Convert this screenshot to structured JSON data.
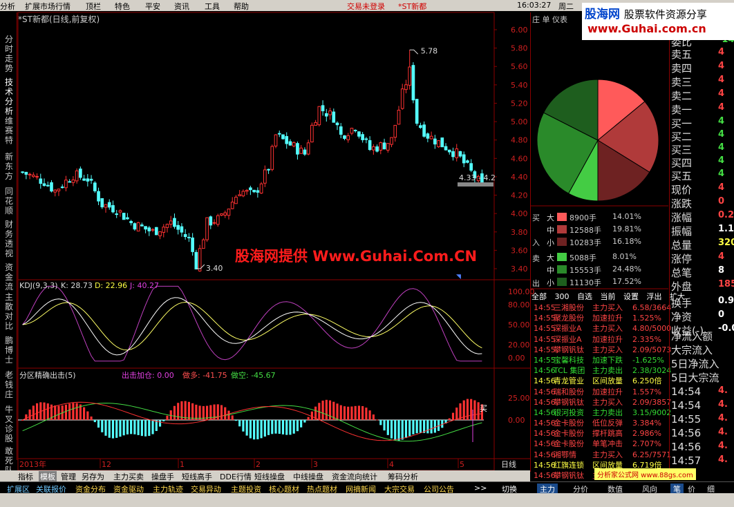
{
  "menu": {
    "items": [
      "分析",
      "扩展市场行情",
      "顶栏",
      "特色",
      "平安",
      "资讯",
      "工具",
      "帮助"
    ],
    "status_login": "交易未登录",
    "status_stock": "*ST新都",
    "clock": "16:03:27",
    "weekday": "周二"
  },
  "logo": {
    "site": "股海网",
    "tagline": "股票软件资源分享",
    "url": "www.Guhai.com.cn"
  },
  "left_tabs": [
    "分时走势",
    "技术分析",
    "维赛特",
    "新东方",
    "同花顺",
    "财务透视",
    "资金流",
    "主散对比",
    "鹏博士",
    "老钱庄",
    "牛叉诊股",
    "敢死队"
  ],
  "chart": {
    "title": "*ST新都(日线,前复权)",
    "y_ticks": [
      "6.00",
      "5.80",
      "5.60",
      "5.40",
      "5.20",
      "5.00",
      "4.80",
      "4.60",
      "4.40",
      "4.20",
      "4.00",
      "3.80",
      "3.60",
      "3.40"
    ],
    "max_label": "5.78",
    "min_label": "3.40",
    "range_label": "4.33 - 4.2",
    "watermark": "股海网提供 Www.Guhai.Com.CN",
    "x_labels": [
      "2013年",
      "12",
      "1",
      "2",
      "3",
      "4",
      "5"
    ],
    "period": "日线"
  },
  "kdj": {
    "name": "KDJ(9,3,3)",
    "k": "K: 28.73",
    "d": "D: 22.96",
    "j": "J: 40.27",
    "ticks": [
      "100.00",
      "80.00",
      "50.00",
      "20.00",
      "0.00"
    ]
  },
  "macd": {
    "name": "分区精确出击(5)",
    "buy": "出击加仓: 0.00",
    "long": "做多: -41.75",
    "short": "做空: -45.67",
    "ticks": [
      "25.00",
      "0.00"
    ],
    "buy_marker": "买"
  },
  "right_tabs": [
    "庄",
    "单",
    "仪表"
  ],
  "pie": {
    "slices": [
      {
        "pct": 14.01,
        "color": "#ff5a5a"
      },
      {
        "pct": 19.81,
        "color": "#b03a3a"
      },
      {
        "pct": 16.18,
        "color": "#6e2222"
      },
      {
        "pct": 8.01,
        "color": "#44cc44"
      },
      {
        "pct": 24.48,
        "color": "#2a8a2a"
      },
      {
        "pct": 17.52,
        "color": "#1e5e1e"
      }
    ]
  },
  "flow": {
    "buy_side": {
      "label_top": "买",
      "label_bottom": "入",
      "rows": [
        {
          "size": "大",
          "amount": "8900手",
          "pct": "14.01%",
          "color": "#ff5a5a"
        },
        {
          "size": "中",
          "amount": "12588手",
          "pct": "19.81%",
          "color": "#b03a3a"
        },
        {
          "size": "小",
          "amount": "10283手",
          "pct": "16.18%",
          "color": "#6e2222"
        }
      ]
    },
    "sell_side": {
      "label_top": "卖",
      "label_bottom": "出",
      "rows": [
        {
          "size": "大",
          "amount": "5088手",
          "pct": "8.01%",
          "color": "#44cc44"
        },
        {
          "size": "中",
          "amount": "15553手",
          "pct": "24.48%",
          "color": "#2a8a2a"
        },
        {
          "size": "小",
          "amount": "11130手",
          "pct": "17.52%",
          "color": "#1e5e1e"
        }
      ]
    }
  },
  "filter_tabs": [
    "全部",
    "300",
    "自选",
    "当前",
    "设置",
    "浮出",
    "扩大"
  ],
  "deals": [
    {
      "time": "14:55",
      "name": "三湘股份",
      "action": "主力买入",
      "value": "6.58/3664",
      "color": "#ff4444"
    },
    {
      "time": "14:55",
      "name": "聚龙股份",
      "action": "加速拉升",
      "value": "1.525%",
      "color": "#ff4444"
    },
    {
      "time": "14:55",
      "name": "深振业A",
      "action": "主力买入",
      "value": "4.80/5000",
      "color": "#ff4444"
    },
    {
      "time": "14:55",
      "name": "深振业A",
      "action": "加速拉升",
      "value": "2.335%",
      "color": "#ff4444"
    },
    {
      "time": "14:55",
      "name": "攀钢钒钛",
      "action": "主力买入",
      "value": "2.09/5073",
      "color": "#ff4444"
    },
    {
      "time": "14:55",
      "name": "宝馨科技",
      "action": "加速下跌",
      "value": "-1.625%",
      "color": "#33dd33"
    },
    {
      "time": "14:56",
      "name": "TCL 集团",
      "action": "主力卖出",
      "value": "2.38/3024",
      "color": "#33dd33"
    },
    {
      "time": "14:56",
      "name": "青龙管业",
      "action": "区间放量",
      "value": "6.250倍",
      "color": "#ffff44"
    },
    {
      "time": "14:56",
      "name": "瑞和股份",
      "action": "加速拉升",
      "value": "1.557%",
      "color": "#ff4444"
    },
    {
      "time": "14:56",
      "name": "攀钢钒钛",
      "action": "主力买入",
      "value": "2.09/3857",
      "color": "#ff4444"
    },
    {
      "time": "14:56",
      "name": "银河投资",
      "action": "主力卖出",
      "value": "3.15/9002",
      "color": "#33dd33"
    },
    {
      "time": "14:56",
      "name": "金卡股份",
      "action": "低位反弹",
      "value": "3.384%",
      "color": "#ff4444"
    },
    {
      "time": "14:56",
      "name": "金卡股份",
      "action": "撑杆跳高",
      "value": "2.986%",
      "color": "#ff4444"
    },
    {
      "time": "14:56",
      "name": "金卡股份",
      "action": "单笔冲击",
      "value": "2.707%",
      "color": "#ff4444"
    },
    {
      "time": "14:56",
      "name": "湘鄂情",
      "action": "主力买入",
      "value": "6.25/7571",
      "color": "#ff4444"
    },
    {
      "time": "14:56",
      "name": "红旗连锁",
      "action": "区间放量",
      "value": "6.719倍",
      "color": "#ffff44"
    },
    {
      "time": "14:56",
      "name": "攀钢钒钛",
      "action": "主力买入",
      "value": "",
      "color": "#ff4444"
    }
  ],
  "quote": {
    "weibi": "委比",
    "weibi_val": "-14.4",
    "sell_levels": [
      {
        "label": "卖五",
        "val": "4"
      },
      {
        "label": "卖四",
        "val": "4"
      },
      {
        "label": "卖三",
        "val": "4"
      },
      {
        "label": "卖二",
        "val": "4"
      },
      {
        "label": "卖一",
        "val": "4"
      }
    ],
    "buy_levels": [
      {
        "label": "买一",
        "val": "4"
      },
      {
        "label": "买二",
        "val": "4"
      },
      {
        "label": "买三",
        "val": "4"
      },
      {
        "label": "买四",
        "val": "4"
      },
      {
        "label": "买五",
        "val": "4"
      }
    ],
    "stats": [
      {
        "label": "现价",
        "val": "4",
        "color": "#ff4444"
      },
      {
        "label": "涨跌",
        "val": "0",
        "color": "#ff4444"
      },
      {
        "label": "涨幅",
        "val": "0.2",
        "color": "#ff4444"
      },
      {
        "label": "振幅",
        "val": "1.1",
        "color": "#ffffff"
      },
      {
        "label": "总量",
        "val": "320",
        "color": "#ffff44"
      },
      {
        "label": "涨停",
        "val": "4",
        "color": "#ff4444"
      },
      {
        "label": "总笔",
        "val": "8",
        "color": "#ffffff"
      },
      {
        "label": "外盘",
        "val": "185",
        "color": "#ff4444"
      },
      {
        "label": "换手",
        "val": "0.9",
        "color": "#ffffff"
      },
      {
        "label": "净资",
        "val": "0",
        "color": "#ffffff"
      },
      {
        "label": "收益(-)",
        "val": "-0.0",
        "color": "#ffffff"
      }
    ],
    "flows": [
      "净流入额",
      "大宗流入",
      "5日净流入",
      "5日大宗流"
    ],
    "ticks": [
      {
        "time": "14:54",
        "val": "4."
      },
      {
        "time": "14:54",
        "val": "4."
      },
      {
        "time": "14:55",
        "val": "4."
      },
      {
        "time": "14:56",
        "val": "4."
      },
      {
        "time": "14:56",
        "val": "4."
      },
      {
        "time": "14:57",
        "val": "4."
      }
    ]
  },
  "indicator_tabs": [
    "指标",
    "模板",
    "管理",
    "另存为",
    "主力买卖",
    "操盘手",
    "短线高手",
    "DDE行情",
    "短线操盘",
    "中线操盘",
    "资金流向统计",
    "筹码分析"
  ],
  "bottom_tabs": [
    "扩展区",
    "关联报价",
    "资金分布",
    "资金驱动",
    "主力轨迹",
    "交易异动",
    "主题投资",
    "核心题材",
    "热点题材",
    "网摘新闻",
    "大宗交易",
    "公司公告",
    ">>",
    "切换"
  ],
  "right_bottom_tabs": [
    "主力",
    "分价",
    "数值",
    "风向",
    "笔",
    "价",
    "细"
  ],
  "watermark_small": "分析家公式网 www.88gs.com"
}
